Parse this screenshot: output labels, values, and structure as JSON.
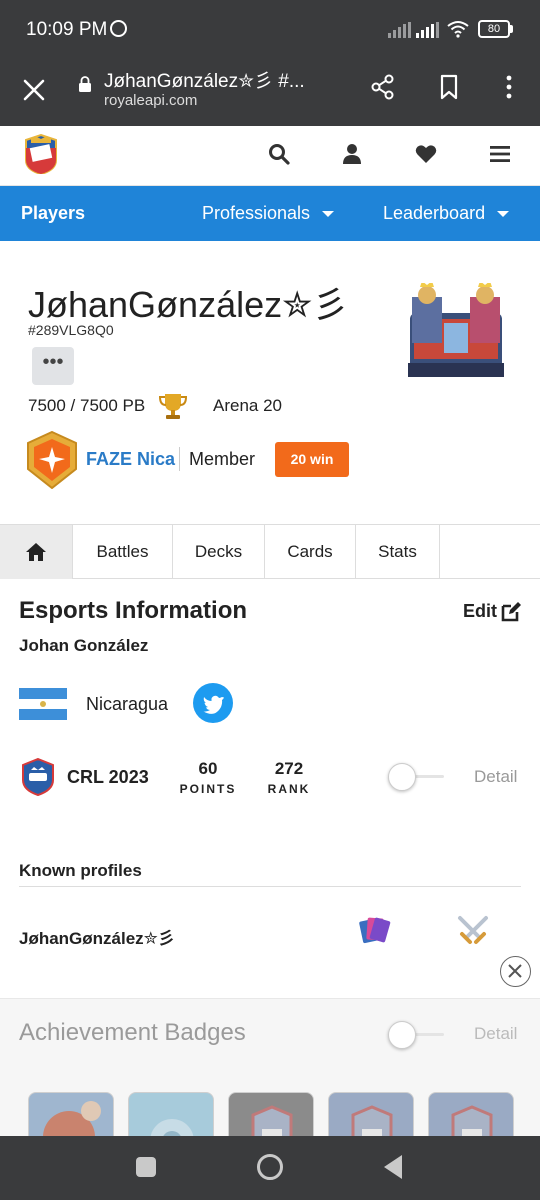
{
  "status_bar": {
    "time": "10:09 PM",
    "battery": "80"
  },
  "browser": {
    "page_title": "JøhanGønzález✮彡 #...",
    "url": "royaleapi.com"
  },
  "site_nav": {
    "players": "Players",
    "professionals": "Professionals",
    "leaderboard": "Leaderboard"
  },
  "profile": {
    "name": "JøhanGønzález✮彡",
    "tag": "#289VLG8Q0",
    "more_label": "•••",
    "trophies": "7500 / 7500 PB",
    "arena": "Arena 20",
    "clan_name": "FAZE Nica",
    "clan_role": "Member",
    "win_badge": "20 win"
  },
  "tabs": [
    "Battles",
    "Decks",
    "Cards",
    "Stats"
  ],
  "esports": {
    "title": "Esports Information",
    "edit_label": "Edit",
    "real_name": "Johan González",
    "country": "Nicaragua",
    "league": "CRL 2023",
    "points_value": "60",
    "points_label": "POINTS",
    "rank_value": "272",
    "rank_label": "RANK",
    "detail_label": "Detail"
  },
  "known_profiles": {
    "title": "Known profiles",
    "profile_name": "JøhanGønzález✮彡"
  },
  "achievements": {
    "title": "Achievement Badges",
    "detail_label": "Detail"
  },
  "colors": {
    "nav_blue": "#1f84d8",
    "clan_link": "#2a7bc7",
    "win_orange": "#f26a1b",
    "twitter_blue": "#1d9bf0"
  }
}
